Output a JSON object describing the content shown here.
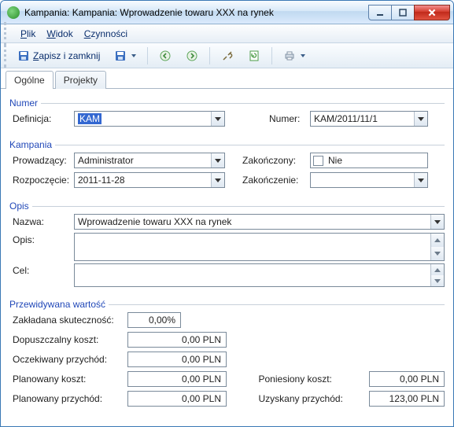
{
  "window": {
    "title": "Kampania: Kampania: Wprowadzenie towaru XXX na rynek"
  },
  "menu": {
    "plik": "Plik",
    "widok": "Widok",
    "czynnosci": "Czynności"
  },
  "toolbar": {
    "save_close": "Zapisz i zamknij"
  },
  "tabs": {
    "ogolne": "Ogólne",
    "projekty": "Projekty"
  },
  "sections": {
    "numer": "Numer",
    "kampania": "Kampania",
    "opis": "Opis",
    "przew": "Przewidywana wartość"
  },
  "labels": {
    "definicja": "Definicja:",
    "numer": "Numer:",
    "prowadzacy": "Prowadzący:",
    "zakonczony": "Zakończony:",
    "rozpoczecie": "Rozpoczęcie:",
    "zakonczenie": "Zakończenie:",
    "nazwa": "Nazwa:",
    "opis": "Opis:",
    "cel": "Cel:",
    "zakl_skut": "Zakładana skuteczność:",
    "dop_koszt": "Dopuszczalny  koszt:",
    "ocz_przych": "Oczekiwany przychód:",
    "plan_koszt": "Planowany koszt:",
    "plan_przych": "Planowany przychód:",
    "pon_koszt": "Poniesiony koszt:",
    "uzys_przych": "Uzyskany przychód:"
  },
  "values": {
    "definicja": "KAM",
    "numer": "KAM/2011/11/1",
    "prowadzacy": "Administrator",
    "zakonczony_text": "Nie",
    "rozpoczecie": "2011-11-28",
    "zakonczenie": "",
    "nazwa": "Wprowadzenie towaru XXX na rynek",
    "opis": "",
    "cel": "",
    "zakl_skut": "0,00%",
    "dop_koszt": "0,00 PLN",
    "ocz_przych": "0,00 PLN",
    "plan_koszt": "0,00 PLN",
    "plan_przych": "0,00 PLN",
    "pon_koszt": "0,00 PLN",
    "uzys_przych": "123,00 PLN"
  }
}
